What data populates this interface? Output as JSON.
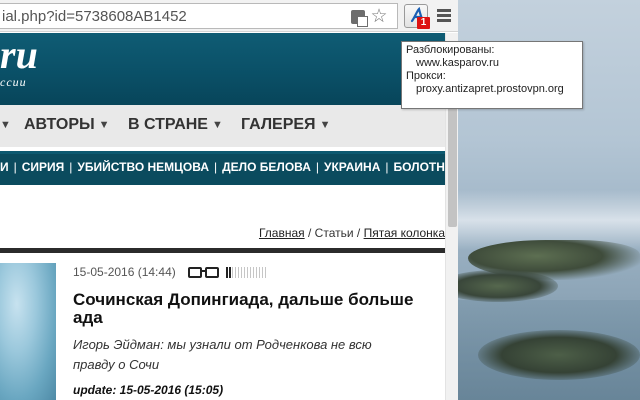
{
  "browser": {
    "url": "ial.php?id=5738608AB1452",
    "extension_badge": "1"
  },
  "tooltip": {
    "unblocked_label": "Разблокированы:",
    "unblocked_site": "www.kasparov.ru",
    "proxy_label": "Прокси:",
    "proxy_host": "proxy.antizapret.prostovpn.org"
  },
  "site": {
    "logo": "ru",
    "logo_sub": "ссии"
  },
  "nav": {
    "items": [
      {
        "label": "АВТОРЫ"
      },
      {
        "label": "В СТРАНЕ"
      },
      {
        "label": "ГАЛЕРЕЯ"
      }
    ]
  },
  "tags": [
    "И",
    "СИРИЯ",
    "УБИЙСТВО НЕМЦОВА",
    "ДЕЛО БЕЛОВА",
    "УКРАИНА",
    "БОЛОТН"
  ],
  "breadcrumb": {
    "home": "Главная",
    "sep1": " / ",
    "articles": "Статьи",
    "sep2": " / ",
    "section": "Пятая колонка"
  },
  "article": {
    "date": "15-05-2016 (14:44)",
    "rating": 0.15,
    "title": "Сочинская Допингиада, дальше больше ада",
    "lead": "Игорь Эйдман: мы узнали от Родченкова не всю правду о Сочи",
    "update": "update: 15-05-2016 (15:05)"
  },
  "icons": {
    "translate": "translate-icon",
    "star": "bookmark-star-icon",
    "extension": "antizapret-extension-icon",
    "menu": "chrome-menu-icon",
    "glasses": "reading-glasses-icon"
  }
}
